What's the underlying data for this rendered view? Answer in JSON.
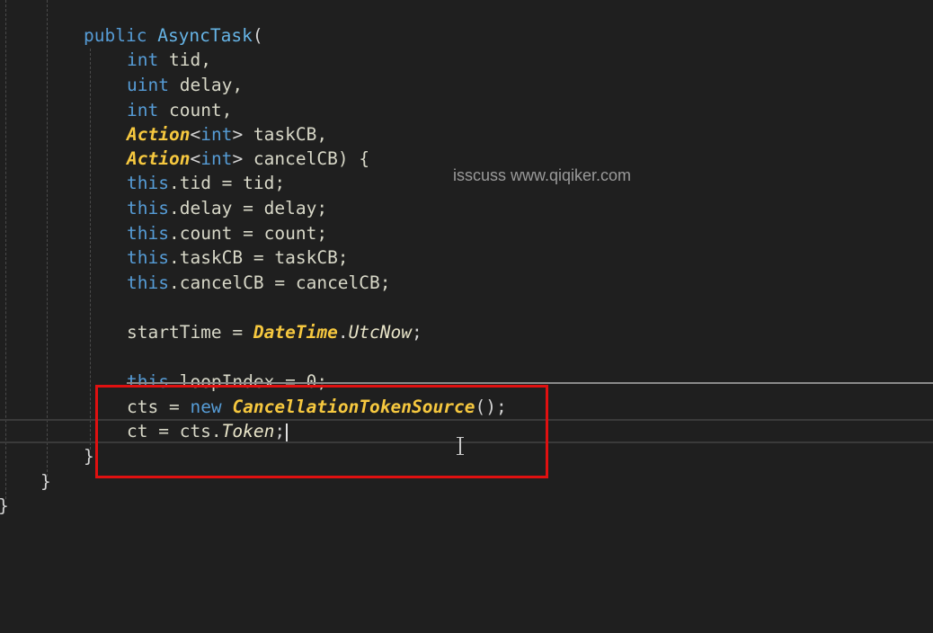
{
  "watermark": "isscuss www.qiqiker.com",
  "code": {
    "l1": {
      "kw": "public",
      "fn": "AsyncTask",
      "tail": "("
    },
    "l2": {
      "kw": "int",
      "rest": " tid,"
    },
    "l3": {
      "kw": "uint",
      "rest": " delay,"
    },
    "l4": {
      "kw": "int",
      "rest": " count,"
    },
    "l5": {
      "type": "Action",
      "lt": "<",
      "kw": "int",
      "gt": ">",
      "rest": " taskCB,"
    },
    "l6": {
      "type": "Action",
      "lt": "<",
      "kw": "int",
      "gt": ">",
      "rest": " cancelCB) {"
    },
    "l7": {
      "kw": "this",
      "rest": ".tid = tid;"
    },
    "l8": {
      "kw": "this",
      "rest": ".delay = delay;"
    },
    "l9": {
      "kw": "this",
      "rest": ".count = count;"
    },
    "l10": {
      "kw": "this",
      "rest": ".taskCB = taskCB;"
    },
    "l11": {
      "kw": "this",
      "rest": ".cancelCB = cancelCB;"
    },
    "l12": {
      "lead": "startTime = ",
      "type": "DateTime",
      "dot": ".",
      "prop": "UtcNow",
      "tail": ";"
    },
    "l13": {
      "kw": "this",
      "rest": ".loopIndex = 0;"
    },
    "l14": {
      "lead": "cts = ",
      "kw": "new",
      "sp": " ",
      "type": "CancellationTokenSource",
      "tail": "();"
    },
    "l15": {
      "lead": "ct = cts.",
      "prop": "Token",
      "tail": ";"
    },
    "l16": {
      "text": "}"
    },
    "l17": {
      "text": "}"
    },
    "l18": {
      "text": "}"
    }
  },
  "colors": {
    "background": "#1f1f1f",
    "keyword": "#569cd6",
    "type": "#f6c83f",
    "highlight_box": "#e01010"
  }
}
